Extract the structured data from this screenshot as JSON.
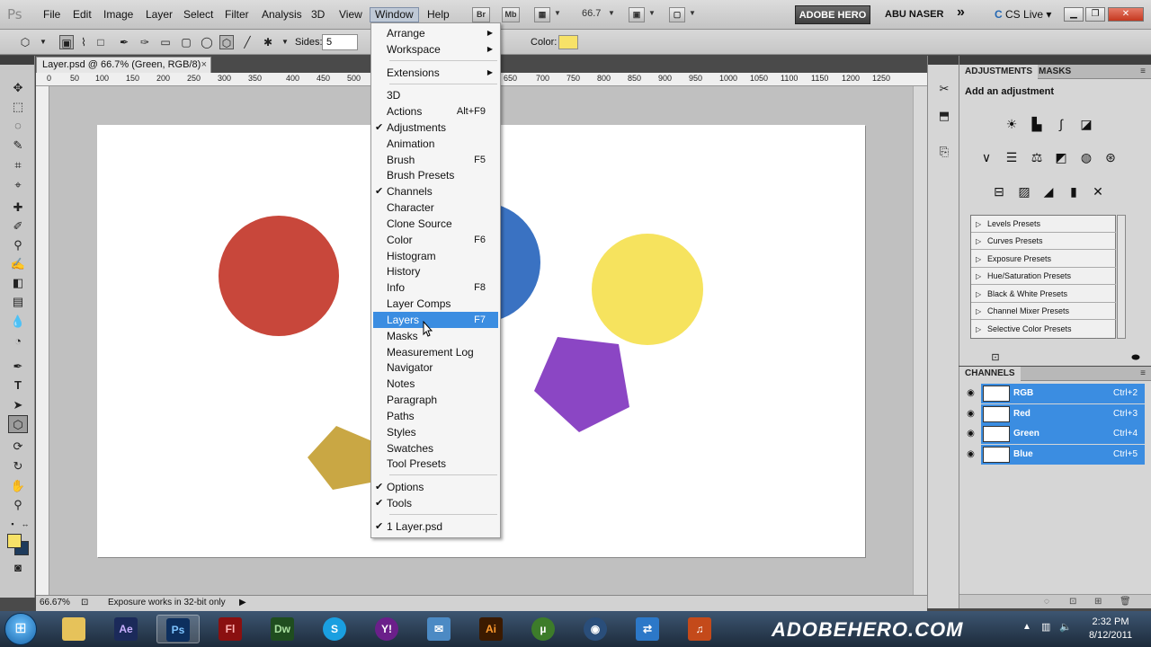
{
  "menubar": {
    "logo": "Ps",
    "items": [
      "File",
      "Edit",
      "Image",
      "Layer",
      "Select",
      "Filter",
      "Analysis",
      "3D",
      "View",
      "Window",
      "Help"
    ],
    "bridge_btn": "Br",
    "minibridge_btn": "Mb",
    "zoom": "66.7",
    "workspace_btn": "ADOBE HERO",
    "workspace_name": "ABU NASER",
    "more": "»",
    "cslive": "CS Live"
  },
  "options": {
    "sides_label": "Sides:",
    "sides_value": "5",
    "color_label": "Color:",
    "color_value": "#f7e268"
  },
  "document": {
    "tab_title": "Layer.psd @ 66.7% (Green, RGB/8)",
    "tab_close": "×",
    "ruler_ticks": [
      "0",
      "50",
      "100",
      "150",
      "200",
      "250",
      "300",
      "350",
      "400",
      "450",
      "500",
      "550",
      "600",
      "650",
      "700",
      "750",
      "800",
      "850",
      "900",
      "950",
      "1000",
      "1050",
      "1100",
      "1150",
      "1200",
      "1250"
    ],
    "shapes": [
      {
        "kind": "circle",
        "color": "#c8473b"
      },
      {
        "kind": "circle",
        "color": "#3a72c2"
      },
      {
        "kind": "circle",
        "color": "#f6e35e"
      },
      {
        "kind": "pentagon",
        "color": "#8b46c4"
      },
      {
        "kind": "pentagon",
        "color": "#c9a744"
      }
    ]
  },
  "status": {
    "zoom": "66.67%",
    "message": "Exposure works in 32-bit only"
  },
  "window_menu": {
    "items": [
      {
        "label": "Arrange",
        "submenu": true
      },
      {
        "label": "Workspace",
        "submenu": true
      },
      {
        "label": "Extensions",
        "submenu": true
      },
      {
        "label": "3D"
      },
      {
        "label": "Actions",
        "shortcut": "Alt+F9"
      },
      {
        "label": "Adjustments",
        "checked": true
      },
      {
        "label": "Animation"
      },
      {
        "label": "Brush",
        "shortcut": "F5"
      },
      {
        "label": "Brush Presets"
      },
      {
        "label": "Channels",
        "checked": true
      },
      {
        "label": "Character"
      },
      {
        "label": "Clone Source"
      },
      {
        "label": "Color",
        "shortcut": "F6"
      },
      {
        "label": "Histogram"
      },
      {
        "label": "History"
      },
      {
        "label": "Info",
        "shortcut": "F8"
      },
      {
        "label": "Layer Comps"
      },
      {
        "label": "Layers",
        "shortcut": "F7",
        "highlighted": true
      },
      {
        "label": "Masks"
      },
      {
        "label": "Measurement Log"
      },
      {
        "label": "Navigator"
      },
      {
        "label": "Notes"
      },
      {
        "label": "Paragraph"
      },
      {
        "label": "Paths"
      },
      {
        "label": "Styles"
      },
      {
        "label": "Swatches"
      },
      {
        "label": "Tool Presets"
      },
      {
        "label": "Options",
        "checked": true
      },
      {
        "label": "Tools",
        "checked": true
      },
      {
        "label": "1 Layer.psd",
        "checked": true
      }
    ]
  },
  "adjustments": {
    "tabs": [
      "ADJUSTMENTS",
      "MASKS"
    ],
    "title": "Add an adjustment",
    "icons_row1": [
      "brightness-icon",
      "levels-icon",
      "curves-icon",
      "exposure-icon"
    ],
    "icons_row2": [
      "vibrance-icon",
      "hue-saturation-icon",
      "color-balance-icon",
      "black-white-icon",
      "photo-filter-icon",
      "channel-mixer-icon"
    ],
    "icons_row3": [
      "invert-icon",
      "posterize-icon",
      "threshold-icon",
      "gradient-map-icon",
      "selective-color-icon"
    ],
    "presets": [
      "Levels Presets",
      "Curves Presets",
      "Exposure Presets",
      "Hue/Saturation Presets",
      "Black & White Presets",
      "Channel Mixer Presets",
      "Selective Color Presets"
    ]
  },
  "channels": {
    "title": "CHANNELS",
    "rows": [
      {
        "name": "RGB",
        "shortcut": "Ctrl+2"
      },
      {
        "name": "Red",
        "shortcut": "Ctrl+3"
      },
      {
        "name": "Green",
        "shortcut": "Ctrl+4"
      },
      {
        "name": "Blue",
        "shortcut": "Ctrl+5"
      }
    ]
  },
  "taskbar": {
    "apps": [
      "Explorer",
      "Ae",
      "Ps",
      "Fl",
      "Dw",
      "Skype",
      "Yahoo",
      "Live",
      "Ai",
      "uTorrent",
      "Webcam",
      "TeamViewer",
      "Music"
    ],
    "brand": "ADOBEHERO.COM",
    "time": "2:32 PM",
    "date": "8/12/2011"
  }
}
